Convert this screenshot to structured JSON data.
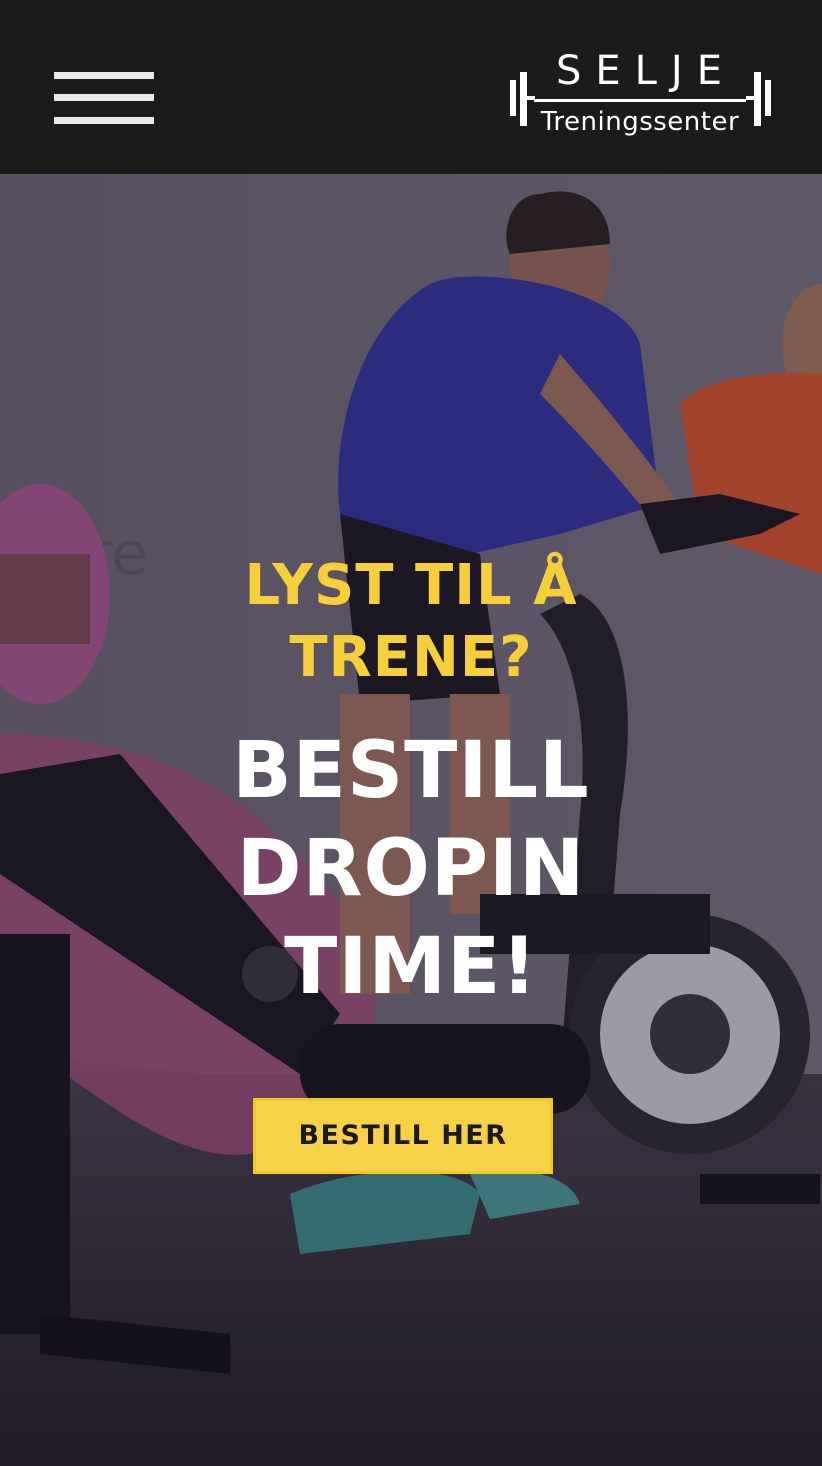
{
  "header": {
    "menu_icon": "hamburger-menu-icon",
    "logo": {
      "name": "SELJE",
      "subtitle": "Treningssenter",
      "icon": "barbell-icon"
    }
  },
  "hero": {
    "kicker_line1": "LYST TIL Å",
    "kicker_line2": "TRENE?",
    "headline_line1": "BESTILL",
    "headline_line2": "DROPIN",
    "headline_line3": "TIME!",
    "cta_label": "BESTILL HER",
    "image": "gym-spinning-class-photo"
  },
  "colors": {
    "header_bg": "#1b1b1b",
    "accent_yellow": "#f6cf3a",
    "button_yellow": "#f7d247",
    "text_white": "#ffffff"
  }
}
